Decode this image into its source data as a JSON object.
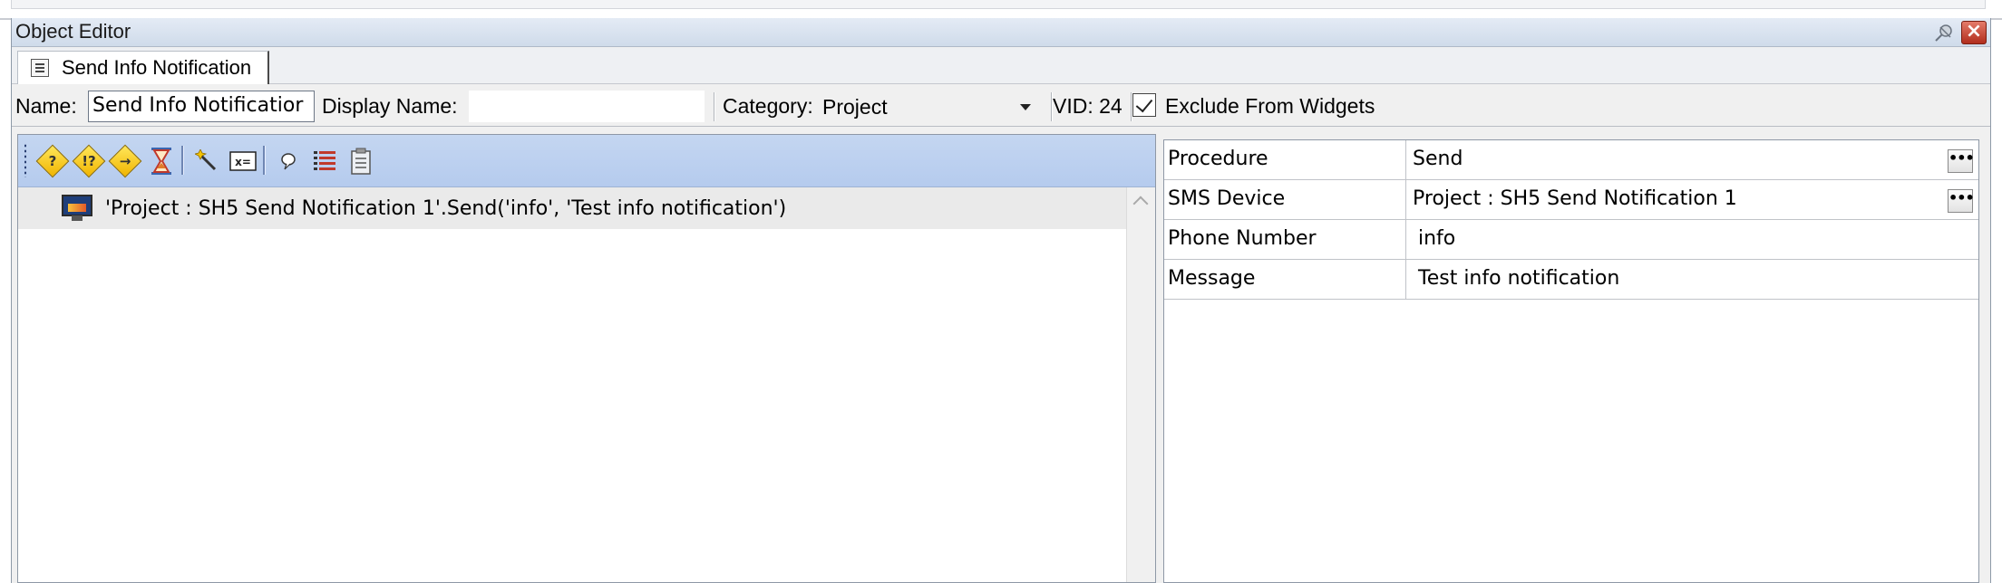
{
  "window": {
    "title": "Object Editor"
  },
  "tabs": [
    {
      "label": "Send Info Notification"
    }
  ],
  "properties_bar": {
    "name_label": "Name:",
    "name_value": "Send Info Notificatior",
    "display_name_label": "Display Name:",
    "display_name_value": "",
    "category_label": "Category:",
    "category_value": "Project",
    "vid_label": "VID: 24",
    "exclude_label": "Exclude From Widgets",
    "exclude_checked": true
  },
  "toolbar": {
    "icons": [
      "if-condition-icon",
      "else-if-condition-icon",
      "goto-icon",
      "delay-hourglass-icon",
      "wizard-wand-icon",
      "set-variable-icon",
      "comment-icon",
      "list-icon",
      "clipboard-icon"
    ]
  },
  "actions": [
    {
      "text": "'Project : SH5 Send Notification 1'.Send('info', 'Test info notification')",
      "icon": "monitor-icon"
    }
  ],
  "property_grid": [
    {
      "name": "Procedure",
      "value": "Send",
      "has_button": true
    },
    {
      "name": "SMS Device",
      "value": "Project : SH5 Send Notification 1",
      "has_button": true
    },
    {
      "name": "Phone Number",
      "value": "info",
      "has_button": false
    },
    {
      "name": "Message",
      "value": "Test info notification",
      "has_button": false
    }
  ],
  "colors": {
    "toolbar_bg": "#b5cbee",
    "title_gradient": "#cfdbea",
    "close_red": "#b12d1d"
  }
}
